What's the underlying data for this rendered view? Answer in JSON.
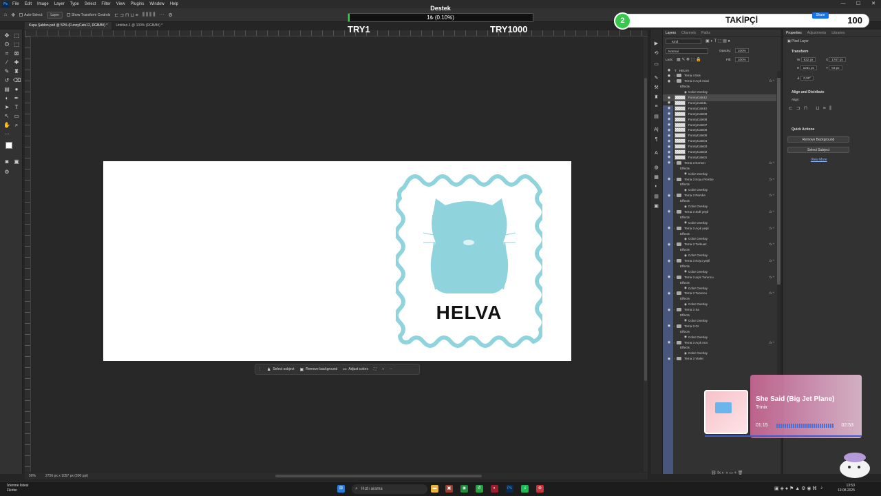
{
  "app": {
    "menu": [
      "File",
      "Edit",
      "Image",
      "Layer",
      "Type",
      "Select",
      "Filter",
      "View",
      "Plugins",
      "Window",
      "Help"
    ],
    "window_controls": [
      "—",
      "☐",
      "✕"
    ]
  },
  "options_bar": {
    "auto_select_label": "Auto-Select:",
    "auto_select_value": "Layer",
    "transform_controls_label": "Show Transform Controls"
  },
  "doc_tabs": [
    {
      "label": "Kupa Şablon.psd @ 50% (FunnyCats12, RGB/8#) *",
      "active": true
    },
    {
      "label": "Untitled-1 @ 100% (RGB/8#) *",
      "active": false
    }
  ],
  "overlay": {
    "destek_title": "Destek",
    "destek_amount": "1₺ (0.10%)",
    "destek_progress": 0.001,
    "try_left": "TRY1",
    "try_right": "TRY1000",
    "follower_count": "2",
    "follower_title": "TAKİPÇİ",
    "follower_goal": "100",
    "share_label": "Share"
  },
  "canvas": {
    "stamp_text": "HELVA",
    "stamp_color": "#8fd3dc"
  },
  "context_bar": {
    "select_subject": "Select subject",
    "remove_background": "Remove background",
    "adjust_colors": "Adjust colors"
  },
  "status": {
    "zoom": "50%",
    "doc_size": "2756 px x 1057 px (300 ppi)"
  },
  "layers_panel": {
    "tabs": [
      "Layers",
      "Channels",
      "Paths"
    ],
    "filter_kind": "Kind",
    "blend_mode": "Normal",
    "opacity_label": "Opacity:",
    "opacity_value": "100%",
    "lock_label": "Lock:",
    "fill_label": "Fill:",
    "fill_value": "100%",
    "rows": [
      {
        "name": "HELVA",
        "type": "text"
      },
      {
        "name": "Tema 4 bos",
        "type": "folder"
      },
      {
        "name": "Tema 3 Açık mavi",
        "type": "folder",
        "fx": true
      },
      {
        "name": "Effects",
        "type": "effects"
      },
      {
        "name": "Color Overlay",
        "type": "overlay"
      },
      {
        "name": "FunnyCats12",
        "type": "pixel",
        "selected": true
      },
      {
        "name": "FunnyCats11",
        "type": "pixel"
      },
      {
        "name": "FunnyCats10",
        "type": "pixel"
      },
      {
        "name": "FunnyCats09",
        "type": "pixel"
      },
      {
        "name": "FunnyCats08",
        "type": "pixel"
      },
      {
        "name": "FunnyCats07",
        "type": "pixel"
      },
      {
        "name": "FunnyCats06",
        "type": "pixel"
      },
      {
        "name": "FunnyCats05",
        "type": "pixel"
      },
      {
        "name": "FunnyCats04",
        "type": "pixel"
      },
      {
        "name": "FunnyCats03",
        "type": "pixel"
      },
      {
        "name": "FunnyCats02",
        "type": "pixel"
      },
      {
        "name": "FunnyCats01",
        "type": "pixel"
      },
      {
        "name": "Tema 3 Kırmızı",
        "type": "folder",
        "fx": true
      },
      {
        "name": "Effects",
        "type": "effects"
      },
      {
        "name": "Color Overlay",
        "type": "overlay"
      },
      {
        "name": "Tema 3 Koyu Pembe",
        "type": "folder",
        "fx": true
      },
      {
        "name": "Effects",
        "type": "effects"
      },
      {
        "name": "Color Overlay",
        "type": "overlay"
      },
      {
        "name": "Tema 3 Pembe",
        "type": "folder",
        "fx": true
      },
      {
        "name": "Effects",
        "type": "effects"
      },
      {
        "name": "Color Overlay",
        "type": "overlay"
      },
      {
        "name": "Tema 3 Soft yeşil",
        "type": "folder",
        "fx": true
      },
      {
        "name": "Effects",
        "type": "effects"
      },
      {
        "name": "Color Overlay",
        "type": "overlay"
      },
      {
        "name": "Tema 3 Açık yeşil",
        "type": "folder",
        "fx": true
      },
      {
        "name": "Effects",
        "type": "effects"
      },
      {
        "name": "Color Overlay",
        "type": "overlay"
      },
      {
        "name": "Tema 3 Turkuaz",
        "type": "folder",
        "fx": true
      },
      {
        "name": "Effects",
        "type": "effects"
      },
      {
        "name": "Color Overlay",
        "type": "overlay"
      },
      {
        "name": "Tema 3 Koyu yeşil",
        "type": "folder",
        "fx": true
      },
      {
        "name": "Effects",
        "type": "effects"
      },
      {
        "name": "Color Overlay",
        "type": "overlay"
      },
      {
        "name": "Tema 3 açık Turuncu",
        "type": "folder",
        "fx": true
      },
      {
        "name": "Effects",
        "type": "effects"
      },
      {
        "name": "Color Overlay",
        "type": "overlay"
      },
      {
        "name": "Tema 3 Turuncu",
        "type": "folder",
        "fx": true
      },
      {
        "name": "Effects",
        "type": "effects"
      },
      {
        "name": "Color Overlay",
        "type": "overlay"
      },
      {
        "name": "Tema 3 Sa",
        "type": "folder"
      },
      {
        "name": "Effects",
        "type": "effects"
      },
      {
        "name": "Color Overlay",
        "type": "overlay"
      },
      {
        "name": "Tema 3 Gr",
        "type": "folder"
      },
      {
        "name": "Effects",
        "type": "effects"
      },
      {
        "name": "Color Overlay",
        "type": "overlay"
      },
      {
        "name": "Tema 3 Açık mor",
        "type": "folder",
        "fx": true
      },
      {
        "name": "Effects",
        "type": "effects"
      },
      {
        "name": "Color Overlay",
        "type": "overlay"
      },
      {
        "name": "Tema 3 Violet",
        "type": "folder"
      }
    ]
  },
  "properties_panel": {
    "tabs": [
      "Properties",
      "Adjustments",
      "Libraries"
    ],
    "pixel_layer": "Pixel Layer",
    "transform": "Transform",
    "w": "832 px",
    "x": "1767 px",
    "h": "1031 px",
    "y": "63 px",
    "angle": "0,00°",
    "align": "Align and Distribute",
    "align_sub": "Align:",
    "quick_actions": "Quick Actions",
    "remove_bg": "Remove Background",
    "select_subject": "Select Subject",
    "view_more": "View More"
  },
  "music": {
    "title": "She Said (Big Jet Plane)",
    "artist": "Trinix",
    "elapsed": "01:15",
    "total": "02:53"
  },
  "taskbar": {
    "news_line1": "İzlenme listesi",
    "news_line2": "Fikirler",
    "search_placeholder": "Hızlı arama",
    "time": "13:53",
    "date": "19.08.2025"
  }
}
